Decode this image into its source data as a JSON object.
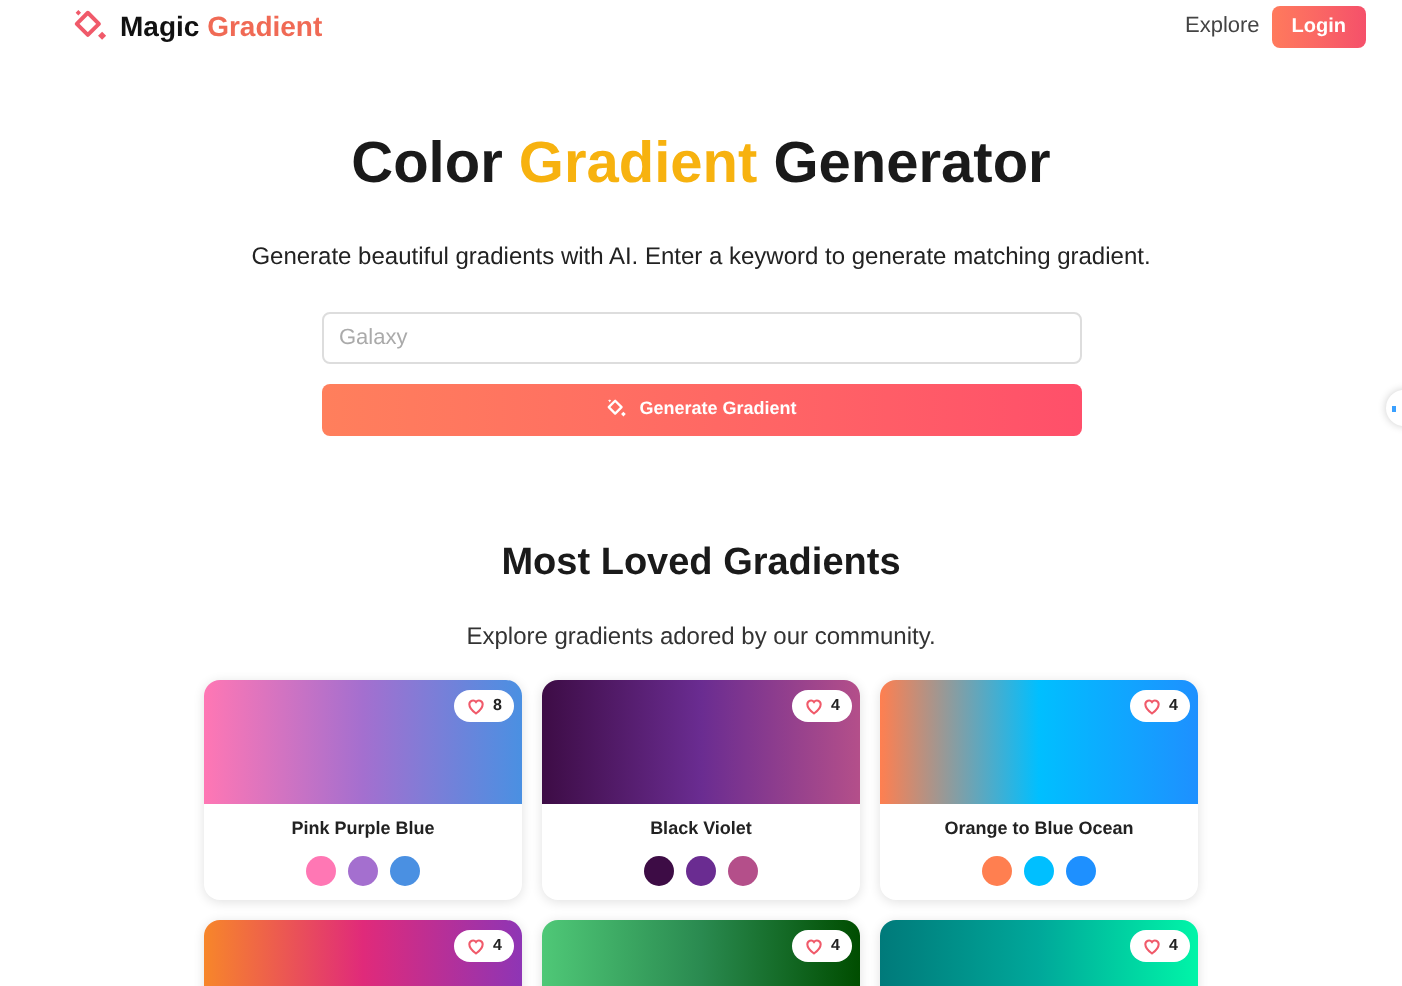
{
  "header": {
    "brand_first": "Magic",
    "brand_second": "Gradient",
    "nav_link": "Explore",
    "login_button": "Login"
  },
  "hero": {
    "title_start": "Color",
    "title_highlight": "Gradient",
    "title_end": "Generator",
    "subtitle": "Generate beautiful gradients with AI. Enter a keyword to generate matching gradient.",
    "search": {
      "placeholder": "Galaxy"
    },
    "generate_button": "Generate Gradient"
  },
  "section": {
    "title": "Most Loved Gradients",
    "subtitle": "Explore gradients adored by our community."
  },
  "cards": [
    {
      "likes": "8",
      "name": "Pink Purple Blue",
      "stops": [
        {
          "color": "#ff77b4"
        },
        {
          "color": "#a46fcf"
        },
        {
          "color": "#4a90e2"
        }
      ]
    },
    {
      "likes": "4",
      "name": "Black Violet",
      "stops": [
        {
          "color": "#3d0c45"
        },
        {
          "color": "#6a2c91"
        },
        {
          "color": "#b44f8a"
        }
      ]
    },
    {
      "likes": "4",
      "name": "Orange to Blue Ocean",
      "stops": [
        {
          "color": "#ff7f50"
        },
        {
          "color": "#00bfff"
        },
        {
          "color": "#1e90ff"
        }
      ]
    },
    {
      "likes": "4",
      "stops": [
        {
          "color": "#f7862a"
        },
        {
          "color": "#e02a7a"
        },
        {
          "color": "#8e35b5"
        }
      ]
    },
    {
      "likes": "4",
      "stops": [
        {
          "color": "#4fc877"
        },
        {
          "color": "#2a8a50"
        },
        {
          "color": "#004d00"
        }
      ]
    },
    {
      "likes": "4",
      "stops": [
        {
          "color": "#007a7a"
        },
        {
          "color": "#00a89a"
        },
        {
          "color": "#00f5a8"
        }
      ]
    }
  ]
}
